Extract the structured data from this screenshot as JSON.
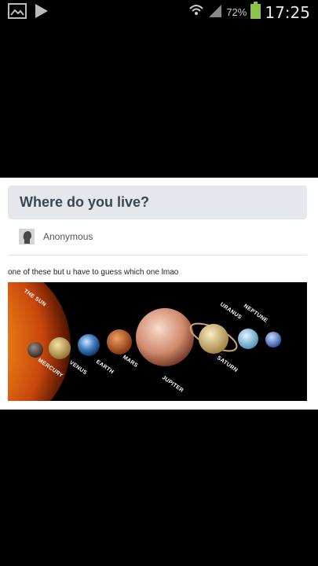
{
  "status_bar": {
    "battery_percent": "72%",
    "time": "17:25",
    "icons": [
      "gallery-icon",
      "play-store-icon",
      "wifi-icon",
      "signal-icon",
      "battery-icon"
    ]
  },
  "post": {
    "question": "Where do you live?",
    "asker": "Anonymous",
    "answer": "one of these but u have to guess which one lmao"
  },
  "image_labels": {
    "sun": "THE SUN",
    "mercury": "MERCURY",
    "venus": "VENUS",
    "earth": "EARTH",
    "mars": "MARS",
    "jupiter": "JUPITER",
    "saturn": "SATURN",
    "uranus": "URANUS",
    "neptune": "NEPTUNE"
  }
}
